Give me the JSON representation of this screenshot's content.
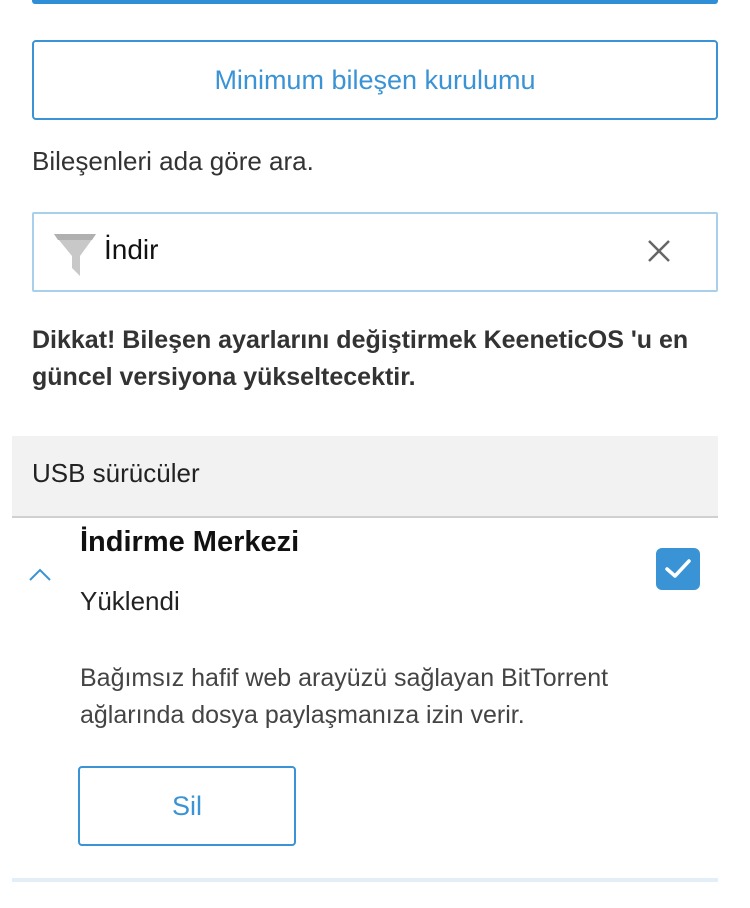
{
  "min_install": {
    "label": "Minimum bileşen kurulumu"
  },
  "search": {
    "label": "Bileşenleri ada göre ara.",
    "value": "İndir"
  },
  "warning": {
    "text": "Dikkat! Bileşen ayarlarını değiştirmek KeeneticOS 'u en güncel versiyona yükseltecektir."
  },
  "group": {
    "title": "USB sürücüler"
  },
  "component": {
    "title": "İndirme Merkezi",
    "status": "Yüklendi",
    "checked": true,
    "description": "Bağımsız hafif web arayüzü sağlayan BitTorrent ağlarında dosya paylaşmanıza izin verir.",
    "remove_label": "Sil"
  },
  "icons": {
    "filter": "filter-icon",
    "clear": "close-icon",
    "expand": "chevron-up-icon",
    "check": "check-icon"
  },
  "colors": {
    "accent": "#3a93d4",
    "group_bg": "#f2f2f2"
  }
}
